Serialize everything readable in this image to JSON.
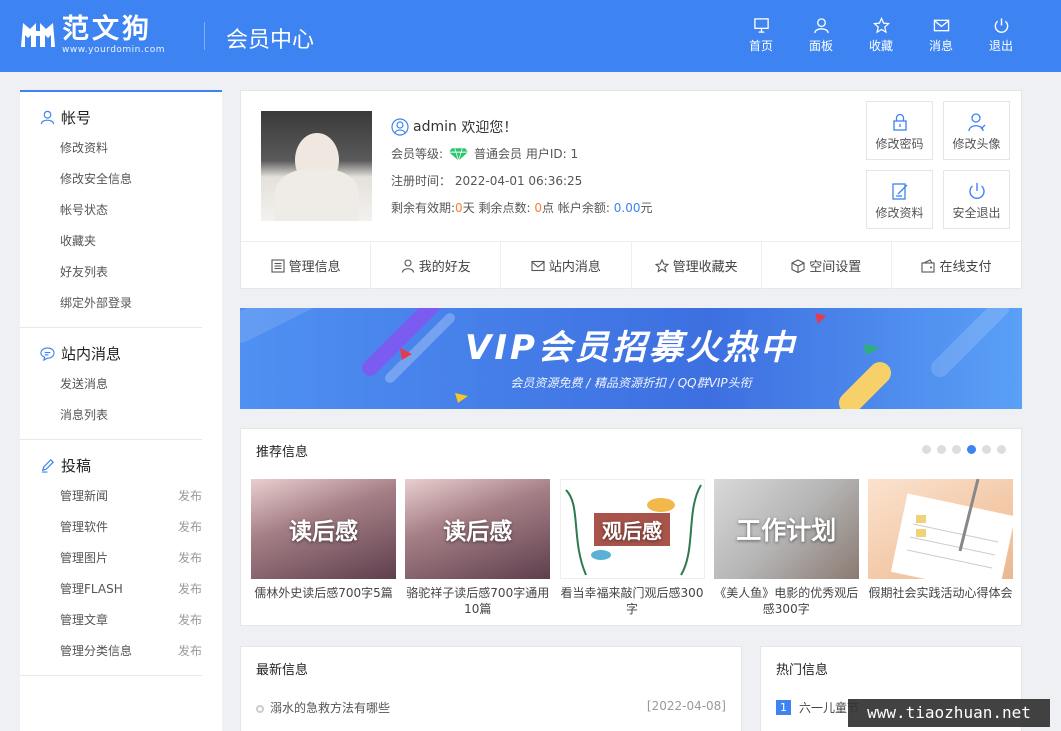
{
  "header": {
    "logo_name": "范文狗",
    "logo_domain": "www.yourdomin.com",
    "title": "会员中心",
    "nav": [
      {
        "label": "首页",
        "icon": "monitor-icon"
      },
      {
        "label": "面板",
        "icon": "user-icon"
      },
      {
        "label": "收藏",
        "icon": "star-icon"
      },
      {
        "label": "消息",
        "icon": "mail-icon"
      },
      {
        "label": "退出",
        "icon": "power-icon"
      }
    ]
  },
  "sidebar": {
    "groups": [
      {
        "title": "帐号",
        "icon": "user-icon",
        "items": [
          "修改资料",
          "修改安全信息",
          "帐号状态",
          "收藏夹",
          "好友列表",
          "绑定外部登录"
        ]
      },
      {
        "title": "站内消息",
        "icon": "chat-icon",
        "items": [
          "发送消息",
          "消息列表"
        ]
      },
      {
        "title": "投稿",
        "icon": "pen-icon",
        "items": [
          {
            "label": "管理新闻",
            "action": "发布"
          },
          {
            "label": "管理软件",
            "action": "发布"
          },
          {
            "label": "管理图片",
            "action": "发布"
          },
          {
            "label": "管理FLASH",
            "action": "发布"
          },
          {
            "label": "管理文章",
            "action": "发布"
          },
          {
            "label": "管理分类信息",
            "action": "发布"
          }
        ]
      }
    ]
  },
  "profile": {
    "username": "admin",
    "welcome": "欢迎您！",
    "level_label": "会员等级:",
    "level_value": "普通会员",
    "uid_label": "用户ID:",
    "uid_value": "1",
    "reg_label": "注册时间：",
    "reg_value": "2022-04-01 06:36:25",
    "valid_label": "剩余有效期:",
    "valid_value": "0",
    "valid_unit": "天",
    "points_label": "剩余点数:",
    "points_value": "0",
    "points_unit": "点",
    "balance_label": "帐户余额:",
    "balance_value": "0.00",
    "balance_unit": "元",
    "quick": [
      "修改密码",
      "修改头像",
      "修改资料",
      "安全退出"
    ],
    "tabs": [
      "管理信息",
      "我的好友",
      "站内消息",
      "管理收藏夹",
      "空间设置",
      "在线支付"
    ]
  },
  "banner": {
    "title": "VIP会员招募火热中",
    "subtitle": "会员资源免费 / 精品资源折扣 / QQ群VIP头衔"
  },
  "recommend": {
    "title": "推荐信息",
    "dots": 6,
    "active_dot": 3,
    "cards": [
      {
        "thumb": "读后感",
        "title": "儒林外史读后感700字5篇"
      },
      {
        "thumb": "读后感",
        "title": "骆驼祥子读后感700字通用10篇"
      },
      {
        "thumb": "观后感",
        "title": "看当幸福来敲门观后感300字"
      },
      {
        "thumb": "工作计划",
        "title": "《美人鱼》电影的优秀观后感300字"
      },
      {
        "thumb": "",
        "title": "假期社会实践活动心得体会"
      }
    ]
  },
  "latest": {
    "title": "最新信息",
    "items": [
      {
        "title": "溺水的急救方法有哪些",
        "date": "[2022-04-08]"
      }
    ]
  },
  "hot": {
    "title": "热门信息",
    "items": [
      {
        "num": "1",
        "title": "六一儿童节"
      }
    ]
  },
  "watermark": "www.tiaozhuan.net",
  "colors": {
    "primary": "#3d84f2",
    "accent": "#ff7b2e"
  }
}
